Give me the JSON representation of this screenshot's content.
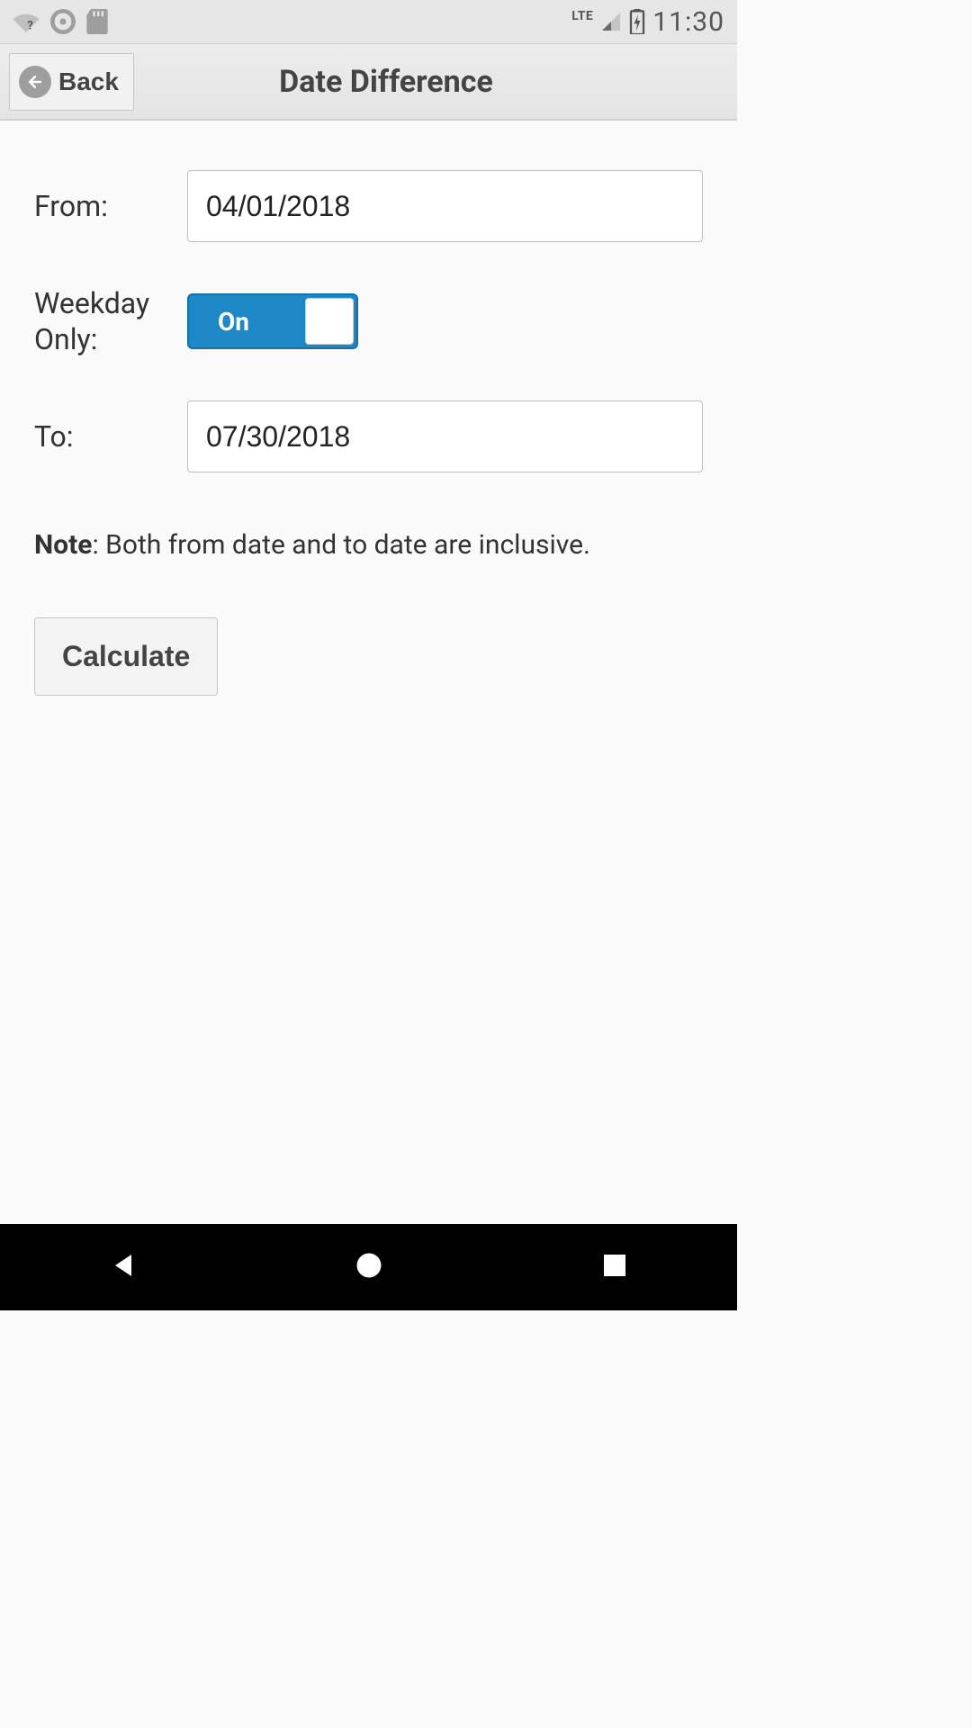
{
  "status_bar": {
    "clock": "11:30",
    "network_label": "LTE"
  },
  "header": {
    "back_label": "Back",
    "title": "Date Difference"
  },
  "form": {
    "from_label": "From:",
    "from_value": "04/01/2018",
    "weekday_label": "Weekday Only:",
    "weekday_toggle_state": "On",
    "to_label": "To:",
    "to_value": "07/30/2018"
  },
  "note": {
    "prefix": "Note",
    "text": ": Both from date and to date are inclusive."
  },
  "calculate_label": "Calculate"
}
